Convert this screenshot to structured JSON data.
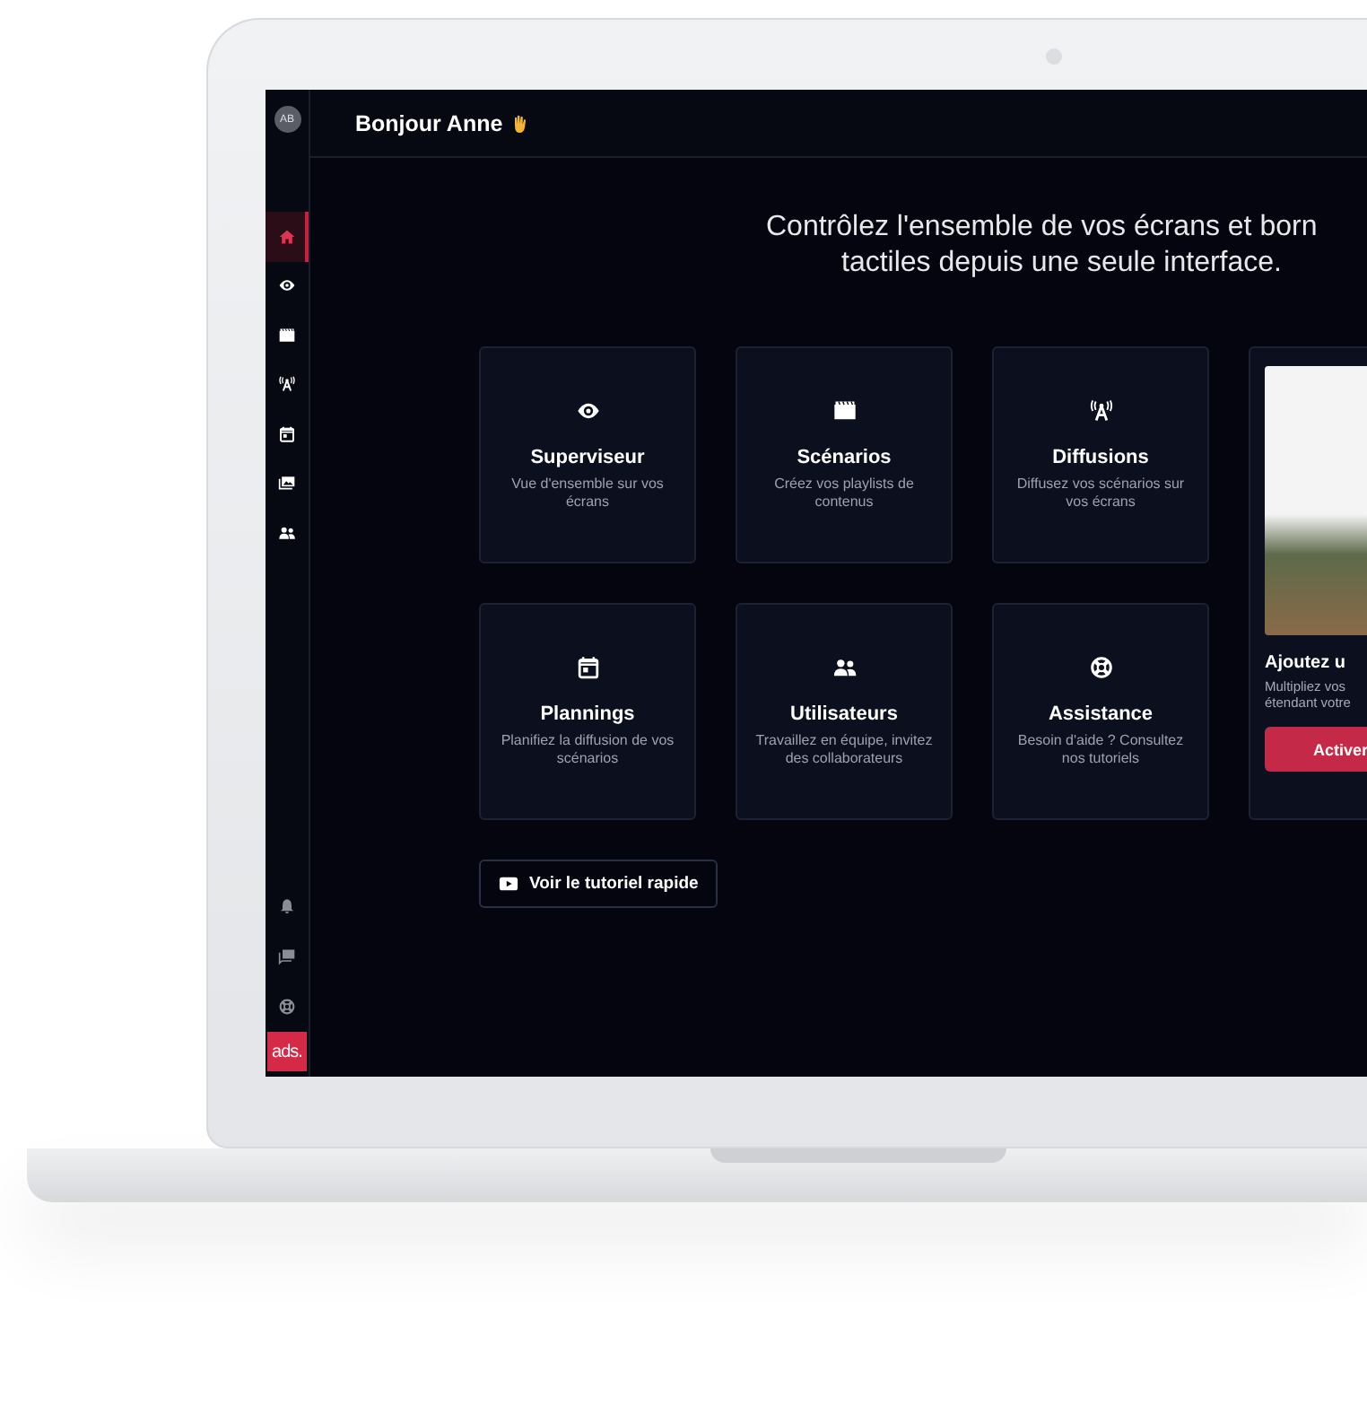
{
  "sidebar": {
    "avatar": "AB",
    "items": [
      {
        "kind": "home",
        "selected": true
      },
      {
        "kind": "eye",
        "selected": false
      },
      {
        "kind": "clapper",
        "selected": false
      },
      {
        "kind": "antenna",
        "selected": false
      },
      {
        "kind": "calendar",
        "selected": false
      },
      {
        "kind": "gallery",
        "selected": false
      },
      {
        "kind": "users",
        "selected": false
      }
    ],
    "bottom_items": [
      {
        "kind": "bell"
      },
      {
        "kind": "chat"
      },
      {
        "kind": "lifebuoy"
      }
    ],
    "logo": "ads."
  },
  "header": {
    "greeting": "Bonjour Anne"
  },
  "headline": [
    "Contrôlez l'ensemble de vos écrans et born",
    "tactiles depuis une seule interface."
  ],
  "cards": [
    {
      "kind": "eye",
      "title": "Superviseur",
      "description": "Vue d'ensemble sur vos écrans"
    },
    {
      "kind": "clapper",
      "title": "Scénarios",
      "description": "Créez vos playlists de contenus"
    },
    {
      "kind": "antenna",
      "title": "Diffusions",
      "description": "Diffusez vos scénarios sur vos écrans"
    },
    {
      "kind": "calendar",
      "title": "Plannings",
      "description": "Planifiez la diffusion de vos scénarios"
    },
    {
      "kind": "users",
      "title": "Utilisateurs",
      "description": "Travaillez en équipe, invitez des collaborateurs"
    },
    {
      "kind": "lifebuoy",
      "title": "Assistance",
      "description": "Besoin d'aide ? Consultez nos tutoriels"
    }
  ],
  "promo": {
    "title": "Ajoutez u",
    "text": [
      "Multipliez vos",
      "étendant votre"
    ],
    "button": "Activer"
  },
  "tutorial_button": "Voir le tutoriel rapide"
}
